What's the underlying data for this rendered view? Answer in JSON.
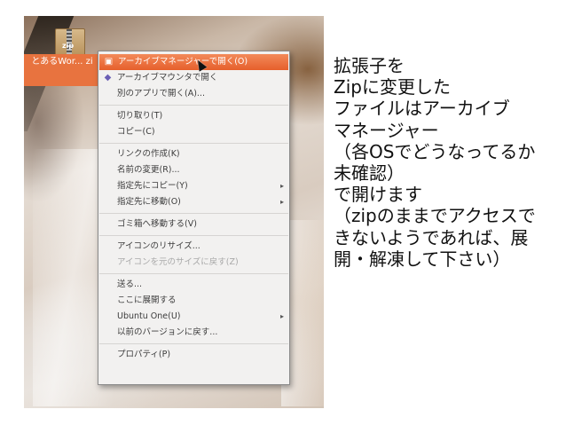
{
  "desktop": {
    "file_label": "とあるWor... zi",
    "file_tag": "zip"
  },
  "context_menu": {
    "highlighted": "アーカイブマネージャーで開く(O)",
    "groups": [
      [
        {
          "label": "アーカイブマネージャーで開く(O)",
          "icon": "archive-manager-icon",
          "highlighted": true
        },
        {
          "label": "アーカイブマウンタで開く",
          "icon": "archive-mounter-icon"
        },
        {
          "label": "別のアプリで開く(A)..."
        }
      ],
      [
        {
          "label": "切り取り(T)"
        },
        {
          "label": "コピー(C)"
        }
      ],
      [
        {
          "label": "リンクの作成(K)"
        },
        {
          "label": "名前の変更(R)..."
        },
        {
          "label": "指定先にコピー(Y)",
          "submenu": true
        },
        {
          "label": "指定先に移動(O)",
          "submenu": true
        }
      ],
      [
        {
          "label": "ゴミ箱へ移動する(V)"
        }
      ],
      [
        {
          "label": "アイコンのリサイズ..."
        },
        {
          "label": "アイコンを元のサイズに戻す(Z)",
          "disabled": true
        }
      ],
      [
        {
          "label": "送る..."
        },
        {
          "label": "ここに展開する"
        },
        {
          "label": "Ubuntu One(U)",
          "submenu": true
        },
        {
          "label": "以前のバージョンに戻す..."
        }
      ],
      [
        {
          "label": "プロパティ(P)"
        }
      ]
    ],
    "submenu_glyph": "▸"
  },
  "note": {
    "lines": [
      "拡張子を",
      "Zipに変更した",
      "ファイルはアーカイブ",
      "マネージャー",
      "（各OSでどうなってるか",
      "未確認）",
      "で開けます",
      "（zipのままでアクセスで",
      "きないようであれば、展",
      "開・解凍して下さい）"
    ]
  },
  "colors": {
    "highlight": "#e8692f",
    "menu_bg": "#f2f1f0",
    "label_bg": "#e8733f"
  }
}
